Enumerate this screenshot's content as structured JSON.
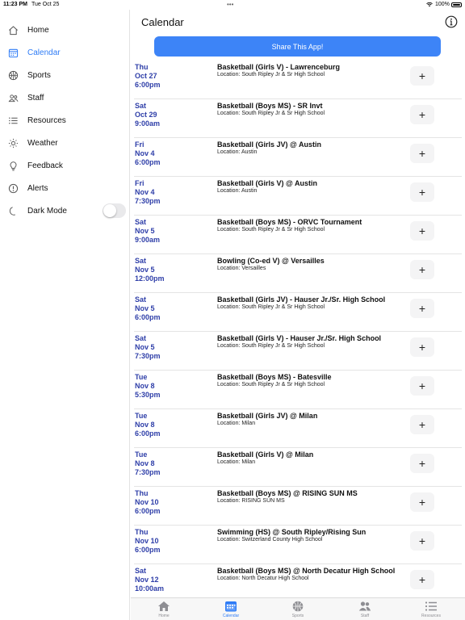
{
  "status_bar": {
    "time": "11:23 PM",
    "date": "Tue Oct 25",
    "dots": "•••",
    "battery": "100%"
  },
  "sidebar": {
    "items": [
      {
        "label": "Home",
        "icon": "house-icon",
        "active": false
      },
      {
        "label": "Calendar",
        "icon": "calendar-icon",
        "active": true
      },
      {
        "label": "Sports",
        "icon": "basketball-icon",
        "active": false
      },
      {
        "label": "Staff",
        "icon": "people-icon",
        "active": false
      },
      {
        "label": "Resources",
        "icon": "list-icon",
        "active": false
      },
      {
        "label": "Weather",
        "icon": "sun-icon",
        "active": false
      },
      {
        "label": "Feedback",
        "icon": "lightbulb-icon",
        "active": false
      },
      {
        "label": "Alerts",
        "icon": "alert-icon",
        "active": false
      },
      {
        "label": "Dark Mode",
        "icon": "moon-icon",
        "active": false
      }
    ],
    "dark_mode_on": false
  },
  "header": {
    "title": "Calendar"
  },
  "share_button": {
    "label": "Share This App!"
  },
  "colors": {
    "accent": "#2f7cf6",
    "share_button": "#3d84f7",
    "date_text": "#2e3ea8"
  },
  "events": [
    {
      "day": "Thu",
      "date": "Oct 27",
      "time": "6:00pm",
      "title": "Basketball (Girls V) - Lawrenceburg",
      "location": "Location: South Ripley Jr & Sr High School"
    },
    {
      "day": "Sat",
      "date": "Oct 29",
      "time": "9:00am",
      "title": "Basketball (Boys MS) - SR Invt",
      "location": "Location: South Ripley Jr & Sr High School"
    },
    {
      "day": "Fri",
      "date": "Nov 4",
      "time": "6:00pm",
      "title": "Basketball (Girls JV) @ Austin",
      "location": "Location: Austin"
    },
    {
      "day": "Fri",
      "date": "Nov 4",
      "time": "7:30pm",
      "title": "Basketball (Girls V) @ Austin",
      "location": "Location: Austin"
    },
    {
      "day": "Sat",
      "date": "Nov 5",
      "time": "9:00am",
      "title": "Basketball (Boys MS) - ORVC Tournament",
      "location": "Location: South Ripley Jr & Sr High School"
    },
    {
      "day": "Sat",
      "date": "Nov 5",
      "time": "12:00pm",
      "title": "Bowling (Co-ed V) @ Versailles",
      "location": "Location: Versailles"
    },
    {
      "day": "Sat",
      "date": "Nov 5",
      "time": "6:00pm",
      "title": "Basketball (Girls JV) - Hauser Jr./Sr. High School",
      "location": "Location: South Ripley Jr & Sr High School"
    },
    {
      "day": "Sat",
      "date": "Nov 5",
      "time": "7:30pm",
      "title": "Basketball (Girls V) - Hauser Jr./Sr. High School",
      "location": "Location: South Ripley Jr & Sr High School"
    },
    {
      "day": "Tue",
      "date": "Nov 8",
      "time": "5:30pm",
      "title": "Basketball (Boys MS) - Batesville",
      "location": "Location: South Ripley Jr & Sr High School"
    },
    {
      "day": "Tue",
      "date": "Nov 8",
      "time": "6:00pm",
      "title": "Basketball (Girls JV) @ Milan",
      "location": "Location: Milan"
    },
    {
      "day": "Tue",
      "date": "Nov 8",
      "time": "7:30pm",
      "title": "Basketball (Girls V) @ Milan",
      "location": "Location: Milan"
    },
    {
      "day": "Thu",
      "date": "Nov 10",
      "time": "6:00pm",
      "title": "Basketball (Boys MS) @ RISING SUN MS",
      "location": "Location: RISING SUN MS"
    },
    {
      "day": "Thu",
      "date": "Nov 10",
      "time": "6:00pm",
      "title": "Swimming (HS) @ South Ripley/Rising Sun",
      "location": "Location: Switzerland County High School"
    },
    {
      "day": "Sat",
      "date": "Nov 12",
      "time": "10:00am",
      "title": "Basketball (Boys MS) @ North Decatur High School",
      "location": "Location: North Decatur High School"
    }
  ],
  "add_button_symbol": "+",
  "tabbar": {
    "tabs": [
      {
        "label": "Home",
        "icon": "house-icon",
        "active": false
      },
      {
        "label": "Calendar",
        "icon": "calendar-icon",
        "active": true
      },
      {
        "label": "Sports",
        "icon": "basketball-icon",
        "active": false
      },
      {
        "label": "Staff",
        "icon": "people-icon",
        "active": false
      },
      {
        "label": "Resources",
        "icon": "list-icon",
        "active": false
      }
    ]
  }
}
